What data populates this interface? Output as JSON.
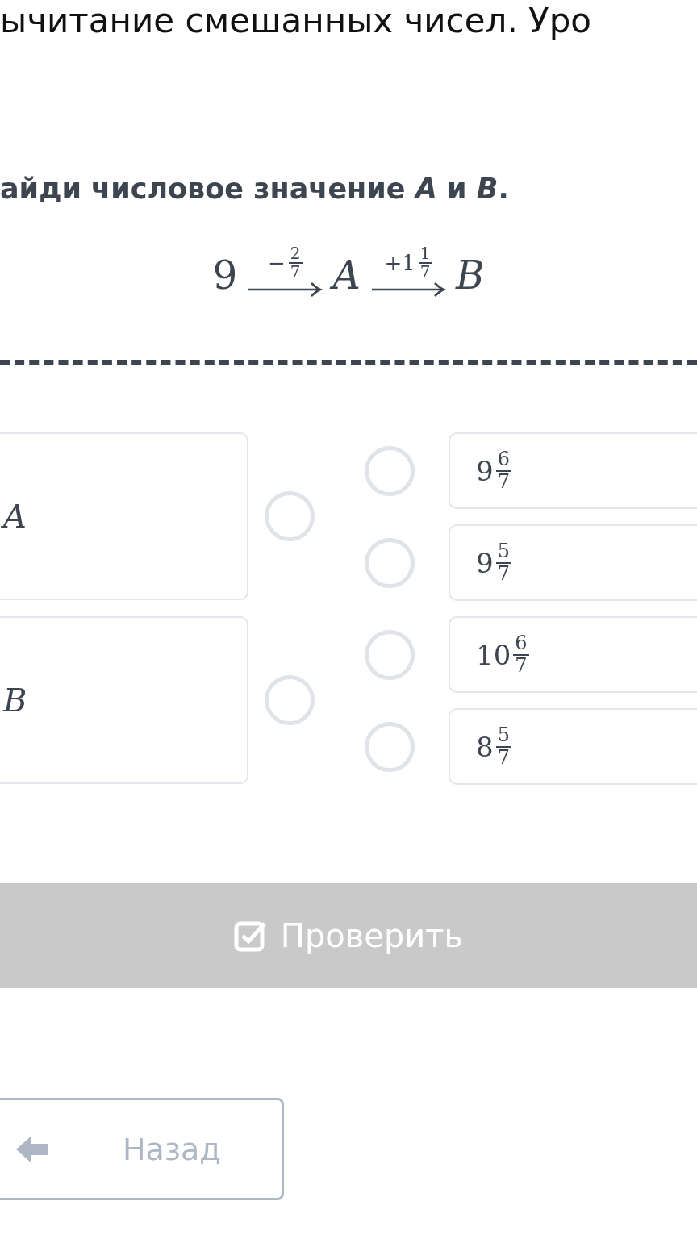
{
  "title": "ычитание смешанных чисел. Уро",
  "question": "айди числовое значение *A* и *B*.",
  "chain": {
    "start": "9",
    "steps": [
      {
        "op": "−",
        "num": "2",
        "den": "7",
        "target": "A"
      },
      {
        "op": "+",
        "whole": "1",
        "num": "1",
        "den": "7",
        "target": "B"
      }
    ]
  },
  "left_items": [
    {
      "label": "A",
      "selected": false
    },
    {
      "label": "B",
      "selected": false
    }
  ],
  "right_items": [
    {
      "whole": "9",
      "num": "6",
      "den": "7",
      "selected": false
    },
    {
      "whole": "9",
      "num": "5",
      "den": "7",
      "selected": false
    },
    {
      "whole": "10",
      "num": "6",
      "den": "7",
      "selected": false
    },
    {
      "whole": "8",
      "num": "5",
      "den": "7",
      "selected": false
    }
  ],
  "check_button": {
    "label": "Проверить"
  },
  "back_button": {
    "label": "Назад"
  }
}
